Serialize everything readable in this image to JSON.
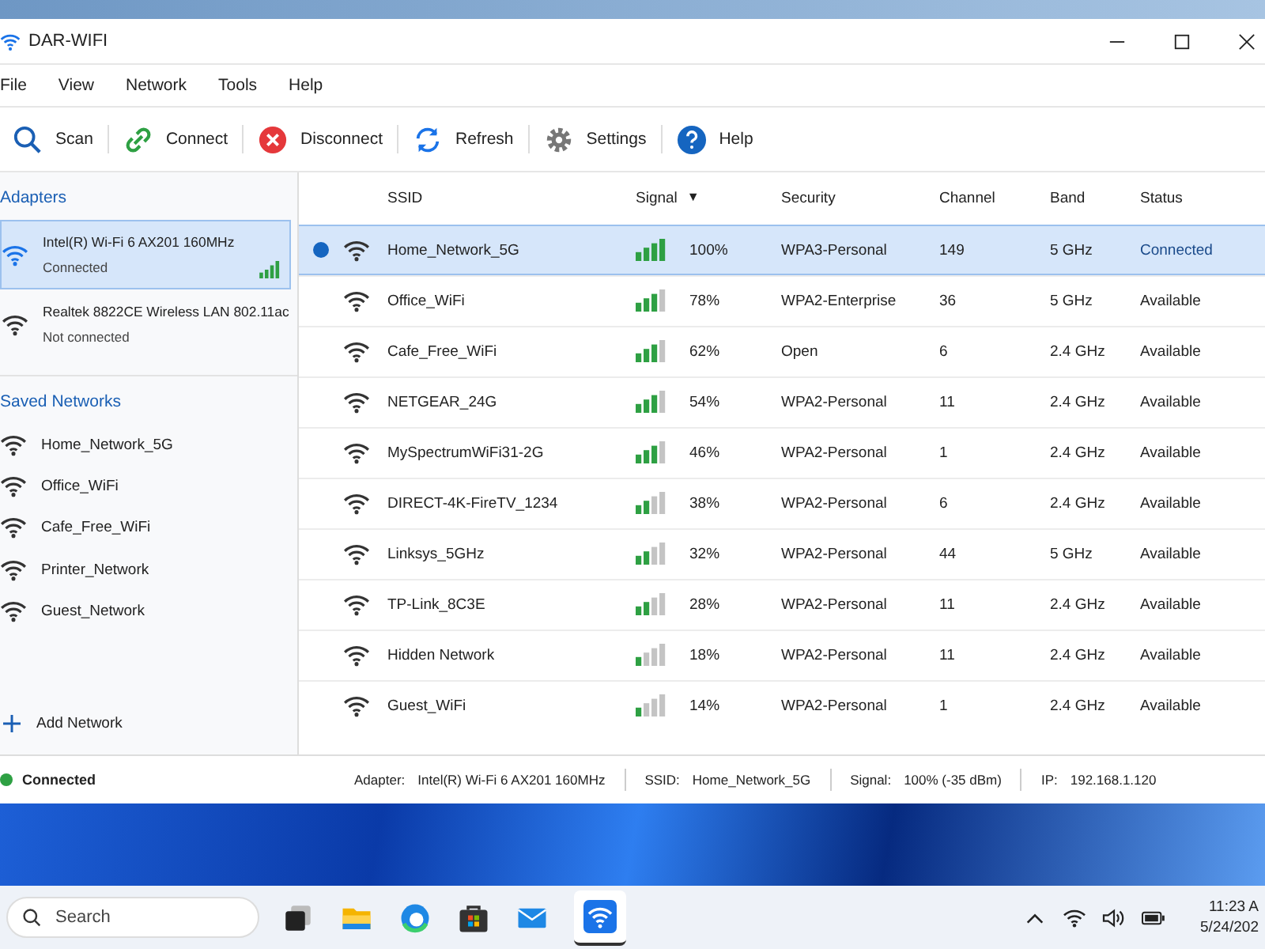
{
  "window": {
    "title": "DAR-WIFI"
  },
  "menu": [
    "File",
    "View",
    "Network",
    "Tools",
    "Help"
  ],
  "toolbar": [
    {
      "label": "Scan",
      "kind": "scan"
    },
    {
      "label": "Connect",
      "kind": "connect"
    },
    {
      "label": "Disconnect",
      "kind": "disconnect"
    },
    {
      "label": "Refresh",
      "kind": "refresh"
    },
    {
      "label": "Settings",
      "kind": "settings"
    },
    {
      "label": "Help",
      "kind": "help"
    }
  ],
  "sidebar": {
    "adapters_title": "Adapters",
    "adapters": [
      {
        "name": "Intel(R) Wi-Fi 6 AX201 160MHz",
        "status": "Connected",
        "selected": true
      },
      {
        "name": "Realtek 8822CE Wireless LAN 802.11ac",
        "status": "Not connected",
        "selected": false
      }
    ],
    "saved_title": "Saved Networks",
    "saved": [
      "Home_Network_5G",
      "Office_WiFi",
      "Cafe_Free_WiFi",
      "Printer_Network",
      "Guest_Network"
    ],
    "add_network": "Add Network"
  },
  "table": {
    "columns": [
      "SSID",
      "Signal",
      "Security",
      "Channel",
      "Band",
      "Status"
    ],
    "sort_indicator": "▼",
    "rows": [
      {
        "ssid": "Home_Network_5G",
        "signal": "100%",
        "security": "WPA3-Personal",
        "channel": "149",
        "band": "5 GHz",
        "status": "Connected",
        "selected": true
      },
      {
        "ssid": "Office_WiFi",
        "signal": "78%",
        "security": "WPA2-Enterprise",
        "channel": "36",
        "band": "5 GHz",
        "status": "Available",
        "selected": false
      },
      {
        "ssid": "Cafe_Free_WiFi",
        "signal": "62%",
        "security": "Open",
        "channel": "6",
        "band": "2.4 GHz",
        "status": "Available",
        "selected": false
      },
      {
        "ssid": "NETGEAR_24G",
        "signal": "54%",
        "security": "WPA2-Personal",
        "channel": "11",
        "band": "2.4 GHz",
        "status": "Available",
        "selected": false
      },
      {
        "ssid": "MySpectrumWiFi31-2G",
        "signal": "46%",
        "security": "WPA2-Personal",
        "channel": "1",
        "band": "2.4 GHz",
        "status": "Available",
        "selected": false
      },
      {
        "ssid": "DIRECT-4K-FireTV_1234",
        "signal": "38%",
        "security": "WPA2-Personal",
        "channel": "6",
        "band": "2.4 GHz",
        "status": "Available",
        "selected": false
      },
      {
        "ssid": "Linksys_5GHz",
        "signal": "32%",
        "security": "WPA2-Personal",
        "channel": "44",
        "band": "5 GHz",
        "status": "Available",
        "selected": false
      },
      {
        "ssid": "TP-Link_8C3E",
        "signal": "28%",
        "security": "WPA2-Personal",
        "channel": "11",
        "band": "2.4 GHz",
        "status": "Available",
        "selected": false
      },
      {
        "ssid": "Hidden Network",
        "signal": "18%",
        "security": "WPA2-Personal",
        "channel": "11",
        "band": "2.4 GHz",
        "status": "Available",
        "selected": false
      },
      {
        "ssid": "Guest_WiFi",
        "signal": "14%",
        "security": "WPA2-Personal",
        "channel": "1",
        "band": "2.4 GHz",
        "status": "Available",
        "selected": false
      }
    ]
  },
  "status_bar": {
    "state": "Connected",
    "connected": true,
    "fields": [
      {
        "label": "Adapter:",
        "value": "Intel(R) Wi-Fi 6 AX201 160MHz"
      },
      {
        "label": "SSID:",
        "value": "Home_Network_5G"
      },
      {
        "label": "Signal:",
        "value": "100% (-35 dBm)"
      },
      {
        "label": "IP:",
        "value": "192.168.1.120"
      }
    ]
  },
  "taskbar": {
    "search_placeholder": "Search",
    "time": "11:23 A",
    "date": "5/24/202"
  }
}
